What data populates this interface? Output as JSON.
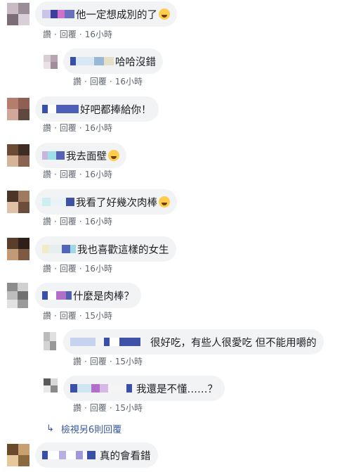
{
  "actions": {
    "like": "讚",
    "reply": "回覆",
    "dot": "·"
  },
  "comments": [
    {
      "text": "他一定想成別的了",
      "emoji": "rofl-emoji",
      "time": "16小時"
    },
    {
      "text": "哈哈沒錯",
      "time": "16小時"
    },
    {
      "text": "好吧都捧給你！",
      "time": "16小時"
    },
    {
      "text": "我去面壁",
      "emoji": "grin-emoji",
      "time": "16小時"
    },
    {
      "text": "我看了好幾次肉棒",
      "emoji": "flushed-emoji",
      "time": "16小時"
    },
    {
      "text": "我也喜歡這樣的女生",
      "time": "16小時"
    },
    {
      "text": "什麼是肉棒？",
      "time": "15小時"
    },
    {
      "text": "很好吃，有些人很愛吃 但不能用嚼的",
      "time": "15小時"
    },
    {
      "text": "我還是不懂……？",
      "time": "15小時"
    },
    {
      "text": "真的會看錯"
    }
  ],
  "view_more": {
    "label": "檢視另6則回覆"
  }
}
